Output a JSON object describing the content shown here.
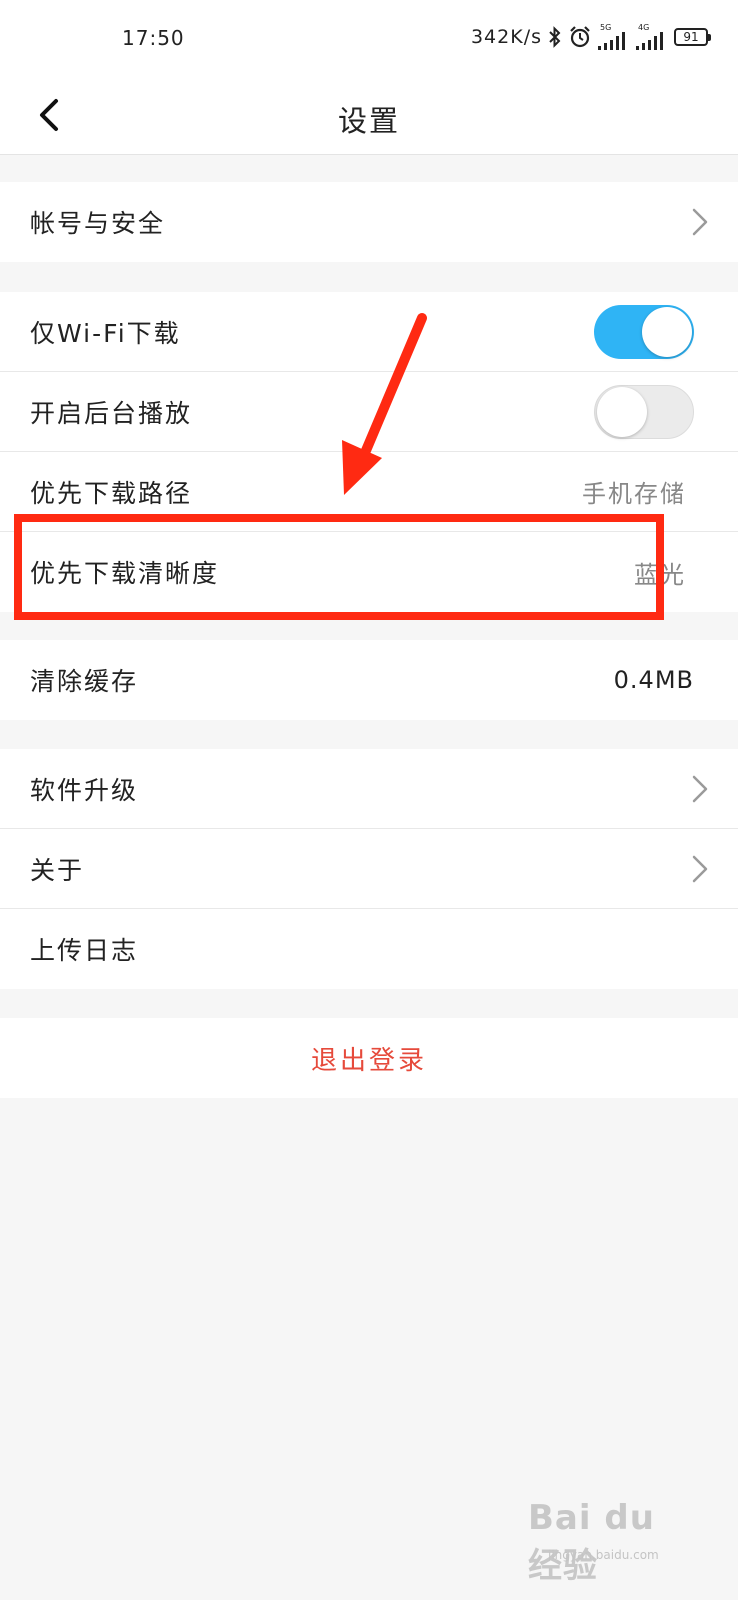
{
  "status_bar": {
    "time": "17:50",
    "speed": "342K/s",
    "signal1_label": "5G",
    "signal2_label": "4G",
    "battery": "91"
  },
  "header": {
    "title": "设置"
  },
  "sections": {
    "account": {
      "label": "帐号与安全"
    },
    "download": {
      "wifi_only_label": "仅Wi-Fi下载",
      "wifi_only_state": true,
      "background_play_label": "开启后台播放",
      "background_play_state": false,
      "path_label": "优先下载路径",
      "path_value": "手机存储",
      "quality_label": "优先下载清晰度",
      "quality_value": "蓝光"
    },
    "cache": {
      "label": "清除缓存",
      "value": "0.4MB"
    },
    "about": {
      "upgrade_label": "软件升级",
      "about_label": "关于",
      "upload_log_label": "上传日志"
    }
  },
  "logout": {
    "label": "退出登录"
  },
  "watermark": {
    "brand": "Bai du 经验",
    "url": "jingyan.baidu.com"
  },
  "colors": {
    "toggle_on": "#2fb4f5",
    "logout_text": "#e64a3b",
    "annotation": "#ff2a12"
  }
}
